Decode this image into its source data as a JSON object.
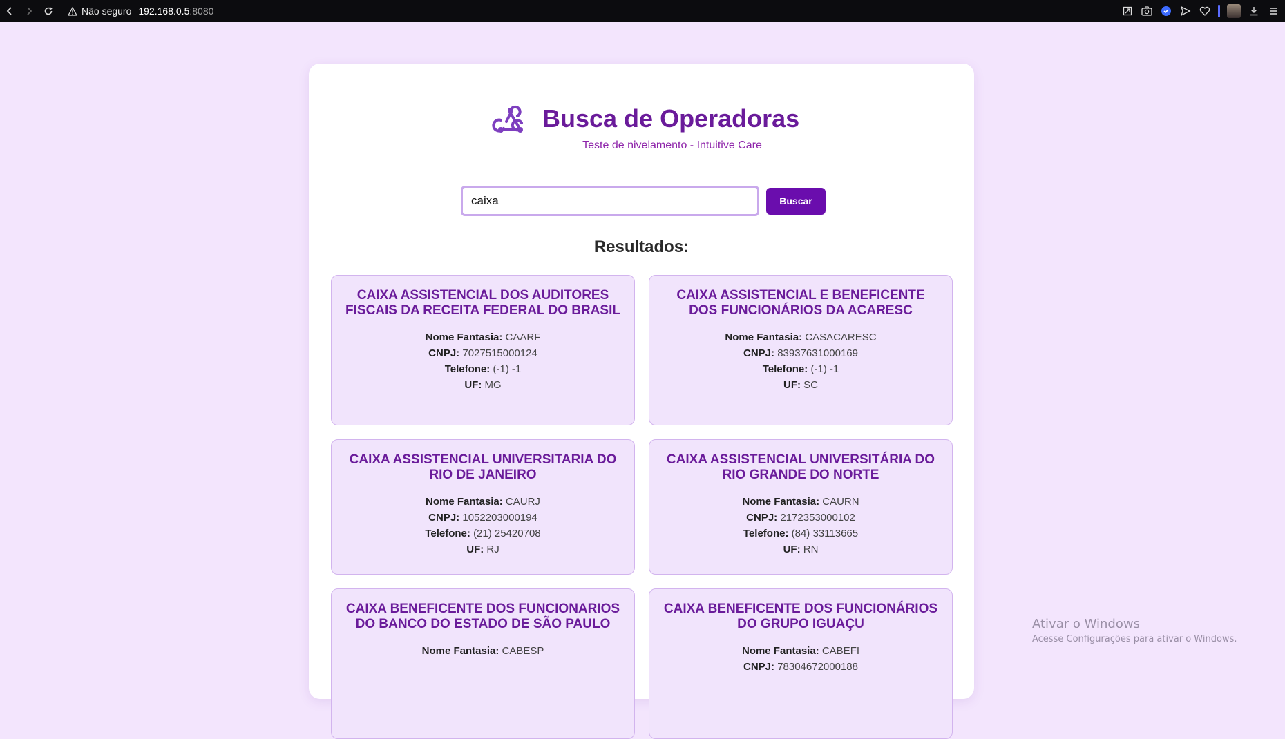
{
  "browser": {
    "security_text": "Não seguro",
    "url_host": "192.168.0.5",
    "url_port": ":8080"
  },
  "header": {
    "title": "Busca de Operadoras",
    "subtitle": "Teste de nivelamento - Intuitive Care",
    "logo_icon": "webhook-icon"
  },
  "search": {
    "value": "caixa",
    "button_label": "Buscar"
  },
  "results": {
    "title": "Resultados:",
    "labels": {
      "nome_fantasia": "Nome Fantasia:",
      "cnpj": "CNPJ:",
      "telefone": "Telefone:",
      "uf": "UF:"
    },
    "items": [
      {
        "name": "CAIXA ASSISTENCIAL DOS AUDITORES FISCAIS DA RECEITA FEDERAL DO BRASIL",
        "nome_fantasia": "CAARF",
        "cnpj": "7027515000124",
        "telefone": "(-1) -1",
        "uf": "MG"
      },
      {
        "name": "CAIXA ASSISTENCIAL E BENEFICENTE DOS FUNCIONÁRIOS DA ACARESC",
        "nome_fantasia": "CASACARESC",
        "cnpj": "83937631000169",
        "telefone": "(-1) -1",
        "uf": "SC"
      },
      {
        "name": "CAIXA ASSISTENCIAL UNIVERSITARIA DO RIO DE JANEIRO",
        "nome_fantasia": "CAURJ",
        "cnpj": "1052203000194",
        "telefone": "(21) 25420708",
        "uf": "RJ"
      },
      {
        "name": "CAIXA ASSISTENCIAL UNIVERSITÁRIA DO RIO GRANDE DO NORTE",
        "nome_fantasia": "CAURN",
        "cnpj": "2172353000102",
        "telefone": "(84) 33113665",
        "uf": "RN"
      },
      {
        "name": "CAIXA BENEFICENTE DOS FUNCIONARIOS DO BANCO DO ESTADO DE SÃO PAULO",
        "nome_fantasia": "CABESP",
        "cnpj": "",
        "telefone": "",
        "uf": ""
      },
      {
        "name": "CAIXA BENEFICENTE DOS FUNCIONÁRIOS DO GRUPO IGUAÇU",
        "nome_fantasia": "CABEFI",
        "cnpj": "78304672000188",
        "telefone": "",
        "uf": ""
      }
    ]
  },
  "watermark": {
    "title": "Ativar o Windows",
    "subtitle": "Acesse Configurações para ativar o Windows."
  }
}
